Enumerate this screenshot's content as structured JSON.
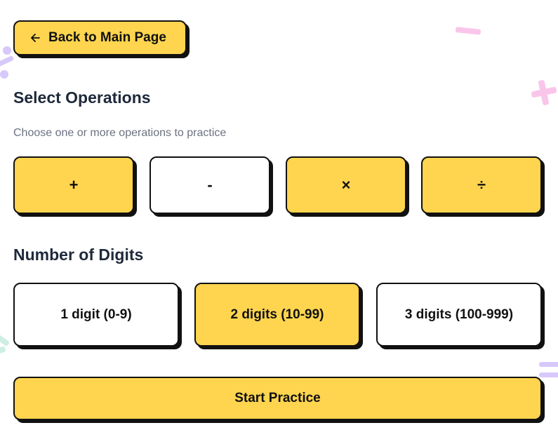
{
  "back_button": {
    "label": "Back to Main Page",
    "icon": "arrow-left-icon"
  },
  "operations": {
    "title": "Select Operations",
    "subtitle": "Choose one or more operations to practice",
    "items": [
      {
        "symbol": "+",
        "selected": true
      },
      {
        "symbol": "-",
        "selected": false
      },
      {
        "symbol": "×",
        "selected": true
      },
      {
        "symbol": "÷",
        "selected": true
      }
    ]
  },
  "digits": {
    "title": "Number of Digits",
    "items": [
      {
        "label": "1 digit (0-9)",
        "selected": false
      },
      {
        "label": "2 digits (10-99)",
        "selected": true
      },
      {
        "label": "3 digits (100-999)",
        "selected": false
      }
    ]
  },
  "start_button": {
    "label": "Start Practice"
  },
  "colors": {
    "accent": "#FFD54F",
    "border": "#111111",
    "heading": "#1e293b",
    "muted": "#6b7280",
    "deco_pink": "#f9c6ea",
    "deco_purple": "#d7c8fb",
    "deco_mint": "#cdeee2"
  },
  "decorations": [
    "minus-deco-icon",
    "plus-deco-icon",
    "divide-deco-icon",
    "equals-deco-icon",
    "mint-deco-icon"
  ]
}
